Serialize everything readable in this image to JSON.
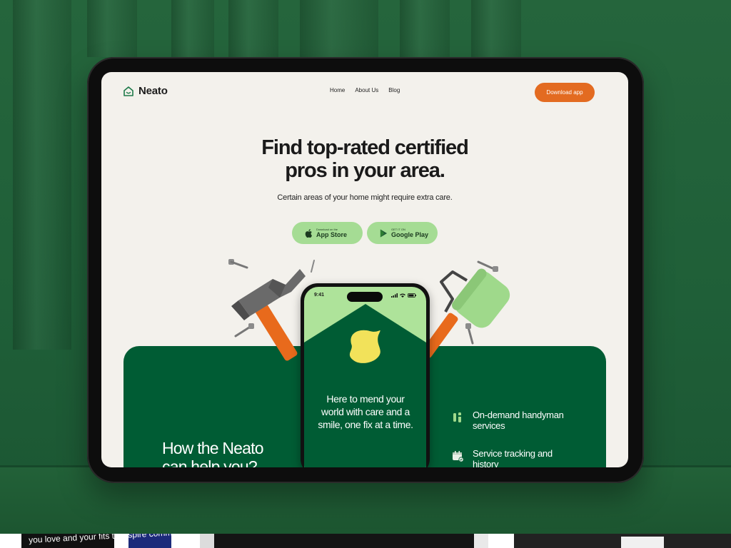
{
  "site": {
    "brand": "Neato",
    "nav": [
      "Home",
      "About Us",
      "Blog"
    ],
    "download_label": "Download app"
  },
  "hero": {
    "title_line1": "Find top-rated certified",
    "title_line2": "pros in your area.",
    "subtitle": "Certain areas of your home might require extra care.",
    "app_store": {
      "small": "Download on the",
      "big": "App Store"
    },
    "google_play": {
      "small": "GET IT ON",
      "big": "Google Play"
    }
  },
  "phone": {
    "time": "9:41",
    "tagline": "Here to mend your world with care and a smile, one fix at a time."
  },
  "section": {
    "heading_line1": "How the Neato",
    "heading_line2": "can help you?",
    "features": [
      {
        "icon": "tools-icon",
        "label": "On-demand handyman services"
      },
      {
        "icon": "calendar-check-icon",
        "label": "Service tracking and history"
      }
    ]
  },
  "background_strip": {
    "caption": "you love and your fits to inspire community"
  },
  "colors": {
    "backdrop": "#1f5a36",
    "screen_bg": "#f3f1ec",
    "accent_orange": "#e36b21",
    "store_button": "#a5dc94",
    "panel_green": "#005c34",
    "phone_light": "#aee39a",
    "blob_yellow": "#f2e25a"
  }
}
